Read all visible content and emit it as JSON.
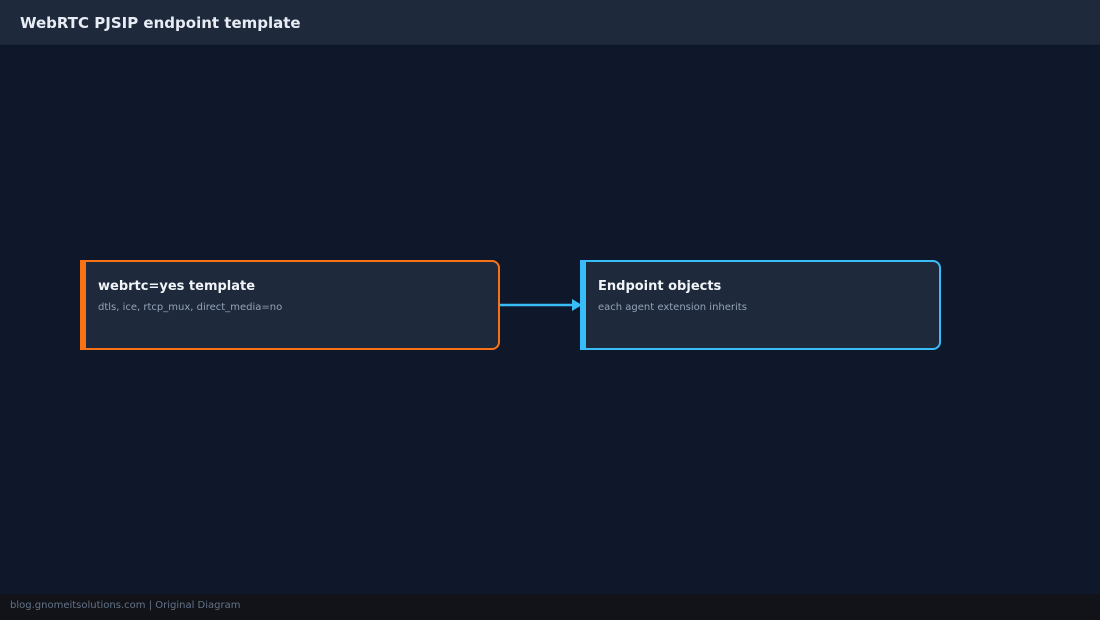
{
  "header": {
    "title": "WebRTC PJSIP endpoint template"
  },
  "diagram": {
    "nodes": [
      {
        "title": "webrtc=yes template",
        "subtitle": "dtls, ice, rtcp_mux, direct_media=no",
        "accent": "#f97316"
      },
      {
        "title": "Endpoint objects",
        "subtitle": "each agent extension inherits",
        "accent": "#38bdf8"
      }
    ],
    "edges": [
      {
        "from": 0,
        "to": 1,
        "color": "#38bdf8"
      }
    ]
  },
  "footer": {
    "text": "blog.gnomeitsolutions.com | Original Diagram"
  },
  "colors": {
    "background": "#0f172a",
    "header": "#1e293b",
    "node_fill": "#1e293b",
    "footer": "#111318"
  }
}
